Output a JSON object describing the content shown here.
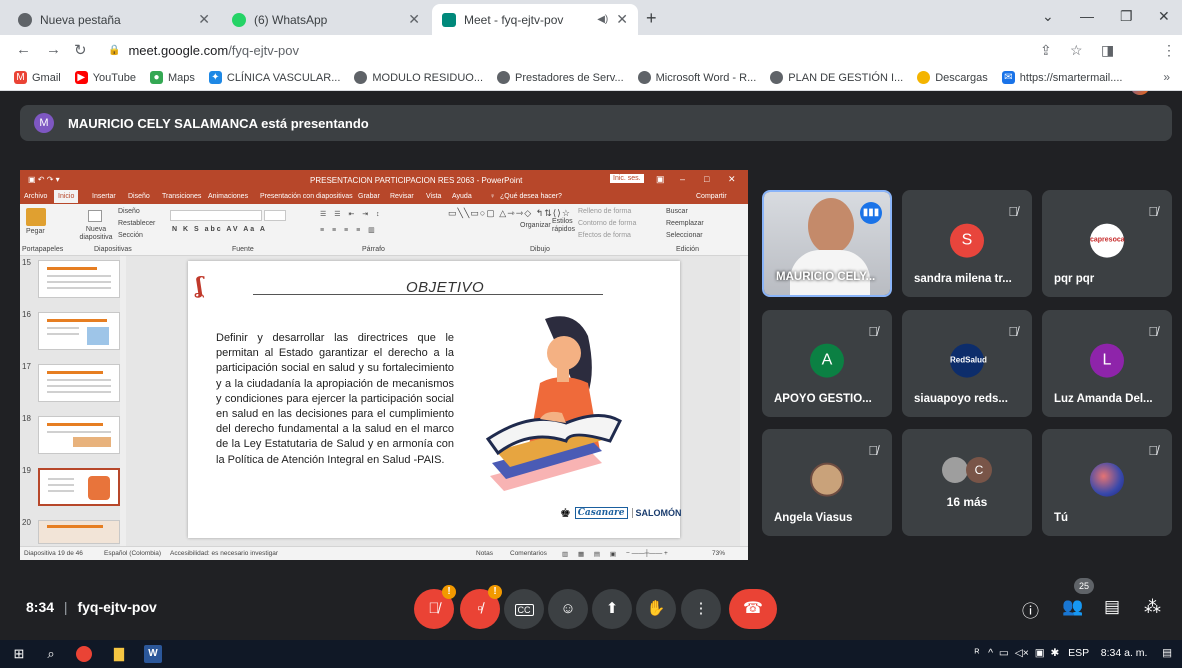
{
  "browser": {
    "tabs": [
      {
        "title": "Nueva pestaña",
        "icon": "chrome-icon",
        "color": "#4285f4"
      },
      {
        "title": "(6) WhatsApp",
        "icon": "whatsapp-icon",
        "color": "#25d366"
      },
      {
        "title": "Meet - fyq-ejtv-pov",
        "icon": "meet-icon",
        "color": "#00897b",
        "active": true
      }
    ],
    "url_host": "meet.google.com",
    "url_path": "/fyq-ejtv-pov",
    "bookmarks": [
      {
        "label": "Gmail",
        "icon": "gmail-icon",
        "color": "#ea4335"
      },
      {
        "label": "YouTube",
        "icon": "youtube-icon",
        "color": "#ff0000"
      },
      {
        "label": "Maps",
        "icon": "maps-icon",
        "color": "#34a853"
      },
      {
        "label": "CLÍNICA VASCULAR...",
        "icon": "clinic-icon",
        "color": "#1e88e5"
      },
      {
        "label": "MODULO RESIDUO...",
        "icon": "globe-icon",
        "color": "#5f6368"
      },
      {
        "label": "Prestadores de Serv...",
        "icon": "globe-icon",
        "color": "#5f6368"
      },
      {
        "label": "Microsoft Word - R...",
        "icon": "globe-icon",
        "color": "#5f6368"
      },
      {
        "label": "PLAN DE GESTIÓN I...",
        "icon": "globe-icon",
        "color": "#5f6368"
      },
      {
        "label": "Descargas",
        "icon": "download-icon",
        "color": "#f4b400"
      },
      {
        "label": "https://smartermail....",
        "icon": "mail-icon",
        "color": "#1a73e8"
      }
    ]
  },
  "meet": {
    "presenter_initial": "M",
    "presenter_text": "MAURICIO CELY SALAMANCA está presentando",
    "meeting_time": "8:34",
    "meeting_code": "fyq-ejtv-pov",
    "people_count": "25",
    "participants": [
      {
        "name": "MAURICIO CELY...",
        "type": "video"
      },
      {
        "name": "sandra milena tr...",
        "initial": "S",
        "color": "#e8453c"
      },
      {
        "name": "pqr pqr",
        "initial": "",
        "color": "#ffffff"
      },
      {
        "name": "APOYO GESTIO...",
        "initial": "A",
        "color": "#0b8043"
      },
      {
        "name": "siauapoyo reds...",
        "initial": "",
        "color": "#0d2d6b"
      },
      {
        "name": "Luz Amanda Del...",
        "initial": "L",
        "color": "#8e24aa"
      },
      {
        "name": "Angela Viasus",
        "initial": "",
        "color": "#c9a27a"
      },
      {
        "name": "16 más",
        "initial": "C",
        "color": "#795548"
      },
      {
        "name": "Tú",
        "initial": "",
        "color": "#3949ab"
      }
    ]
  },
  "powerpoint": {
    "title": "PRESENTACION PARTICIPACION RES 2063 - PowerPoint",
    "signin": "Inic. ses.",
    "share": "Compartir",
    "tabs": [
      "Archivo",
      "Inicio",
      "Insertar",
      "Diseño",
      "Transiciones",
      "Animaciones",
      "Presentación con diapositivas",
      "Grabar",
      "Revisar",
      "Vista",
      "Ayuda",
      "¿Qué desea hacer?"
    ],
    "groups": [
      "Portapapeles",
      "Diapositivas",
      "Fuente",
      "Párrafo",
      "Dibujo",
      "Edición"
    ],
    "ribbon_items": [
      "Pegar",
      "Nueva diapositiva",
      "Diseño",
      "Restablecer",
      "Sección",
      "Organizar",
      "Estilos rápidos",
      "Relleno de forma",
      "Contorno de forma",
      "Efectos de forma",
      "Buscar",
      "Reemplazar",
      "Seleccionar"
    ],
    "thumb_numbers": [
      "15",
      "16",
      "17",
      "18",
      "19",
      "20"
    ],
    "slide_title": "OBJETIVO",
    "slide_body": "Definir y desarrollar las directrices que le permitan al Estado garantizar el derecho a la participación social en salud y su fortalecimiento y a la ciudadanía la apropiación de mecanismos y condiciones para ejercer la participación social en salud en las decisiones para el cumplimiento del derecho fundamental a la salud en el marco de la Ley Estatutaria de Salud y en armonía con la Política de Atención Integral en Salud -PAIS.",
    "footer_logo_1": "Casanare",
    "footer_logo_2": "SALOMÓN",
    "status_slide": "Diapositiva 19 de 46",
    "status_lang": "Español (Colombia)",
    "status_access": "Accesibilidad: es necesario investigar",
    "status_notes": "Notas",
    "status_comments": "Comentarios",
    "zoom": "73%"
  },
  "taskbar": {
    "lang": "ESP",
    "clock": "8:34 a. m."
  }
}
